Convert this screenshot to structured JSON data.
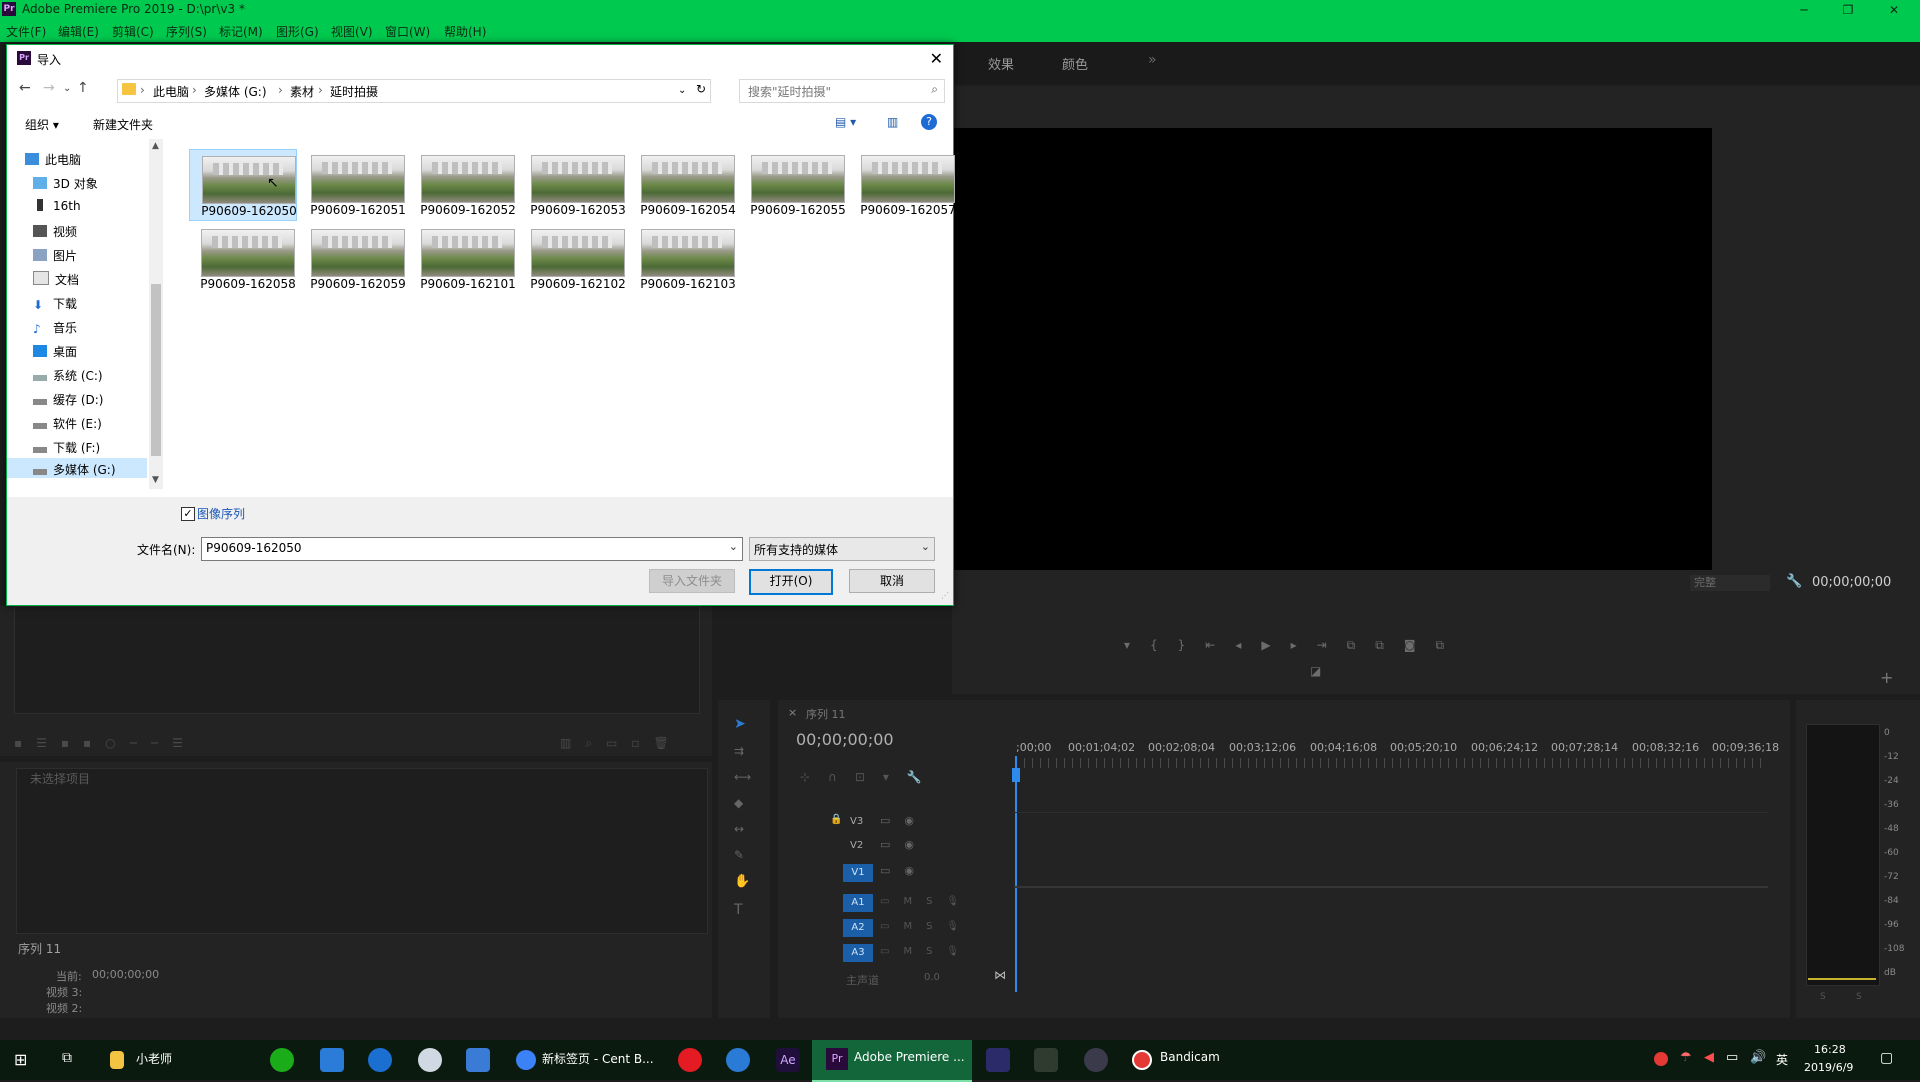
{
  "app": {
    "title": "Adobe Premiere Pro 2019 - D:\\pr\\v3 *",
    "menu": [
      "文件(F)",
      "编辑(E)",
      "剪辑(C)",
      "序列(S)",
      "标记(M)",
      "图形(G)",
      "视图(V)",
      "窗口(W)",
      "帮助(H)"
    ],
    "window_controls": {
      "min": "─",
      "max": "❐",
      "close": "✕"
    },
    "workspace_tabs": [
      "效果",
      "颜色"
    ],
    "overflow": "»"
  },
  "colors": {
    "title_bg": "#00c94f",
    "accent": "#0078d7",
    "premiere_bg": "#1d1d1d",
    "selection": "#cce8ff"
  },
  "dialog": {
    "title": "导入",
    "close": "✕",
    "breadcrumb": [
      "此电脑",
      "多媒体 (G:)",
      "素材",
      "延时拍摄"
    ],
    "search_placeholder": "搜索\"延时拍摄\"",
    "organize": "组织 ▾",
    "new_folder": "新建文件夹",
    "tree": [
      {
        "label": "此电脑",
        "icon": "computer-icon"
      },
      {
        "label": "3D 对象",
        "icon": "3d-objects-icon"
      },
      {
        "label": "16th",
        "icon": "phone-icon"
      },
      {
        "label": "视频",
        "icon": "videos-icon"
      },
      {
        "label": "图片",
        "icon": "pictures-icon"
      },
      {
        "label": "文档",
        "icon": "documents-icon"
      },
      {
        "label": "下载",
        "icon": "downloads-icon"
      },
      {
        "label": "音乐",
        "icon": "music-icon"
      },
      {
        "label": "桌面",
        "icon": "desktop-icon"
      },
      {
        "label": "系统 (C:)",
        "icon": "drive-icon"
      },
      {
        "label": "缓存 (D:)",
        "icon": "drive-icon"
      },
      {
        "label": "软件 (E:)",
        "icon": "drive-icon"
      },
      {
        "label": "下载 (F:)",
        "icon": "drive-icon"
      },
      {
        "label": "多媒体 (G:)",
        "icon": "drive-icon",
        "selected": true
      }
    ],
    "files": [
      "P90609-162050",
      "P90609-162051",
      "P90609-162052",
      "P90609-162053",
      "P90609-162054",
      "P90609-162055",
      "P90609-162057",
      "P90609-162058",
      "P90609-162059",
      "P90609-162101",
      "P90609-162102",
      "P90609-162103"
    ],
    "selected_file": "P90609-162050",
    "image_sequence_label": "图像序列",
    "image_sequence_checked": true,
    "filename_label": "文件名(N):",
    "filename_value": "P90609-162050",
    "filetype_value": "所有支持的媒体",
    "import_folder_btn": "导入文件夹",
    "open_btn": "打开(O)",
    "cancel_btn": "取消"
  },
  "program_monitor": {
    "timecode": "00;00;00;00",
    "fit": "完整"
  },
  "project_panel": {
    "no_selection": "未选择项目",
    "sequence_name": "序列 11",
    "current_label": "当前:",
    "current_value": "00;00;00;00",
    "video3": "视频 3:",
    "video2": "视频 2:"
  },
  "timeline": {
    "tab": "序列 11",
    "timecode": "00;00;00;00",
    "ruler": [
      ";00;00",
      "00;01;04;02",
      "00;02;08;04",
      "00;03;12;06",
      "00;04;16;08",
      "00;05;20;10",
      "00;06;24;12",
      "00;07;28;14",
      "00;08;32;16",
      "00;09;36;18"
    ],
    "video_tracks": [
      "V3",
      "V2",
      "V1"
    ],
    "audio_tracks": [
      "A1",
      "A2",
      "A3"
    ],
    "master": "主声道",
    "master_value": "0.0"
  },
  "meter_labels": [
    "0",
    "-12",
    "-24",
    "-36",
    "-48",
    "-60",
    "-72",
    "-84",
    "-96",
    "-108",
    "dB"
  ],
  "meter_buttons": [
    "S",
    "S"
  ],
  "taskbar": {
    "explorer": "小老师",
    "chrome": "新标签页 - Cent B...",
    "premiere": "Adobe Premiere ...",
    "bandicam": "Bandicam",
    "time": "16:28",
    "date": "2019/6/9",
    "ime": "英"
  }
}
